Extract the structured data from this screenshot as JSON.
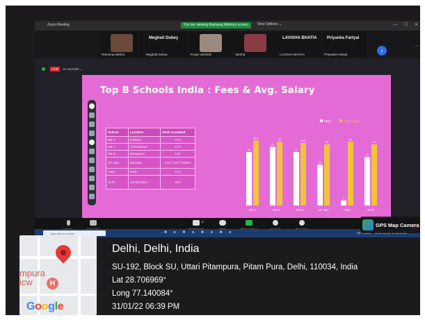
{
  "window": {
    "app_title": "Zoom Meeting",
    "share_banner": "You are viewing Ramanuj Mishra's screen",
    "view_options": "View Options ⌄",
    "window_controls": "—  ☐  ✕"
  },
  "participants": [
    {
      "name": "Ramanuj Mishra"
    },
    {
      "name": "Meghali Dubey",
      "display": "Meghali Dubey"
    },
    {
      "name": "Pooja Vashisth"
    },
    {
      "name": "Varsha"
    },
    {
      "name": "LAVISHA BHATIA",
      "display": "LAVISHA BHATIA"
    },
    {
      "name": "Priyanka Fartyal",
      "display": "Priyanka Fartyal"
    }
  ],
  "stream": {
    "live_badge": "LIVE",
    "platform": "on YouTube ⌄"
  },
  "slide": {
    "title": "Top B Schools India : Fees & Avg. Salary",
    "table": {
      "headers": [
        "School",
        "Location",
        "Tests Accepted"
      ],
      "rows": [
        [
          "IIM C",
          "Kolkata",
          "CAT"
        ],
        [
          "IIM A",
          "Ahmedabad",
          "CAT"
        ],
        [
          "IIM B",
          "Bangalore",
          "CAT"
        ],
        [
          "SP Jain",
          "Mumbai",
          "CAT / XAT / GMAT"
        ],
        [
          "FMS",
          "Delhi",
          "CAT"
        ],
        [
          "XLRI",
          "Jamshedpur",
          "XAT"
        ]
      ]
    }
  },
  "chart_data": {
    "type": "bar",
    "categories": [
      "IIM C",
      "IIM A",
      "IIM B",
      "SP Jain",
      "FMS",
      "XLRI"
    ],
    "series": [
      {
        "name": "Fees",
        "values": [
          21,
          23,
          21,
          16,
          2,
          19
        ],
        "color": "#ffffff"
      },
      {
        "name": "Avg. Salary",
        "values": [
          25.5,
          25,
          24.5,
          24,
          25,
          24
        ],
        "color": "#f0c33b"
      }
    ],
    "legend_position": "top",
    "grid": false,
    "ylim": [
      0,
      30
    ]
  },
  "toolbar": {
    "unmute": "Unmute",
    "start_video": "Start Video",
    "participants": "Participants",
    "participants_count": "47",
    "chat": "Chat",
    "share_screen": "Share Screen",
    "record": "Record",
    "reactions": "Reactions"
  },
  "taskbar": {
    "search_placeholder": "Type here to search",
    "tray": "13°C Clear  ⌃  ENG  06:39 PM  31/01/22"
  },
  "gps": {
    "watermark": "GPS Map Camera",
    "map_label": "mpura\nicw",
    "map_logo": "Google",
    "city": "Delhi, Delhi, India",
    "address": "SU-192, Block SU, Uttari Pitampura, Pitam Pura, Delhi, 110034, India",
    "lat": "Lat 28.706969°",
    "long": "Long 77.140084°",
    "datetime": "31/01/22 06:39 PM"
  },
  "colors": {
    "slide_bg": "#e46bd6",
    "fees": "#ffffff",
    "salary": "#f0c33b",
    "live": "#d9262c"
  }
}
